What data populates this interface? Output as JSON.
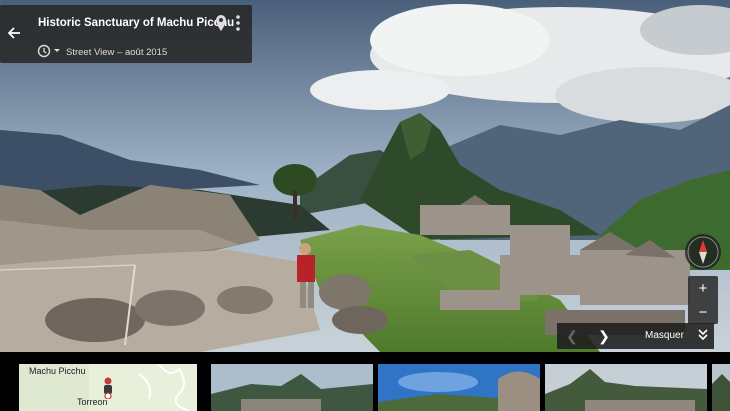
{
  "infocard": {
    "title": "Historic Sanctuary of Machu Picchu",
    "date": "Street View – août 2015"
  },
  "controls": {
    "zoom_in": "+",
    "zoom_out": "−",
    "hide_label": "Masquer"
  },
  "minimap": {
    "labels": [
      "Machu Picchu",
      "Torreon"
    ]
  },
  "icons": [
    "back-arrow-icon",
    "map-pin-icon",
    "more-vert-icon",
    "history-clock-icon",
    "compass-icon",
    "chevron-left-icon",
    "chevron-right-icon",
    "chevrons-down-icon",
    "pegman-icon"
  ],
  "colors": {
    "card_bg": "#282828",
    "compass_red": "#e53935",
    "map_bg": "#e8f0dc"
  }
}
